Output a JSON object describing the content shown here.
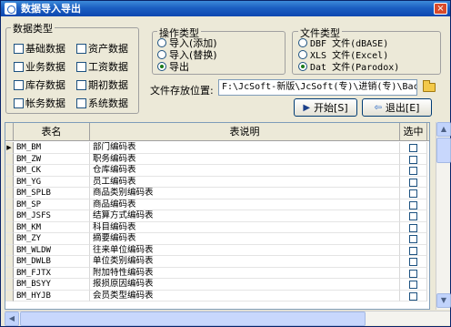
{
  "window": {
    "title": "数据导入导出",
    "close_glyph": "×"
  },
  "data_types": {
    "legend": "数据类型",
    "items": [
      "基础数据",
      "资产数据",
      "业务数据",
      "工资数据",
      "库存数据",
      "期初数据",
      "帐务数据",
      "系统数据"
    ]
  },
  "operation": {
    "legend": "操作类型",
    "options": [
      "导入(添加)",
      "导入(替换)",
      "导出"
    ],
    "selected": "导出"
  },
  "file_type": {
    "legend": "文件类型",
    "options": [
      "DBF 文件(dBASE)",
      "XLS 文件(Excel)",
      "Dat 文件(Parodox)"
    ],
    "selected": "Dat 文件(Parodox)"
  },
  "path": {
    "label": "文件存放位置:",
    "value": "F:\\JcSoft-新版\\JcSoft(专)\\进销(专)\\Backup"
  },
  "buttons": {
    "start": "开始[S]",
    "exit": "退出[E]"
  },
  "icons": {
    "folder": "folder-open-icon",
    "start": "play-icon",
    "exit": "exit-icon"
  },
  "table": {
    "headers": [
      "表名",
      "表说明",
      "选中"
    ],
    "rows": [
      [
        "BM_BM",
        "部门编码表"
      ],
      [
        "BM_ZW",
        "职务编码表"
      ],
      [
        "BM_CK",
        "仓库编码表"
      ],
      [
        "BM_YG",
        "员工编码表"
      ],
      [
        "BM_SPLB",
        "商品类别编码表"
      ],
      [
        "BM_SP",
        "商品编码表"
      ],
      [
        "BM_JSFS",
        "结算方式编码表"
      ],
      [
        "BM_KM",
        "科目编码表"
      ],
      [
        "BM_ZY",
        "摘要编码表"
      ],
      [
        "BM_WLDW",
        "往来单位编码表"
      ],
      [
        "BM_DWLB",
        "单位类别编码表"
      ],
      [
        "BM_FJTX",
        "附加特性编码表"
      ],
      [
        "BM_BSYY",
        "报损原因编码表"
      ],
      [
        "BM_HYJB",
        "会员类型编码表"
      ]
    ]
  }
}
